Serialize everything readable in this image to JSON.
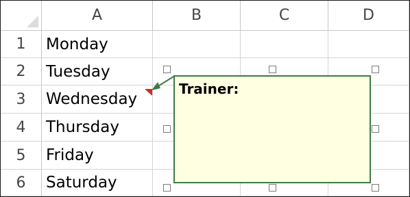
{
  "spreadsheet": {
    "column_headers": [
      "A",
      "B",
      "C",
      "D"
    ],
    "rows": [
      {
        "number": "1",
        "value": "Monday"
      },
      {
        "number": "2",
        "value": "Tuesday"
      },
      {
        "number": "3",
        "value": "Wednesday"
      },
      {
        "number": "4",
        "value": "Thursday"
      },
      {
        "number": "5",
        "value": "Friday"
      },
      {
        "number": "6",
        "value": "Saturday"
      }
    ]
  },
  "comment": {
    "author": "Trainer:",
    "text": "",
    "cell": "A3"
  },
  "colors": {
    "comment_fill": "#ffffe1",
    "comment_border": "#3c7a45",
    "indicator": "#d42a1f",
    "gridline": "#d4d4d4"
  }
}
